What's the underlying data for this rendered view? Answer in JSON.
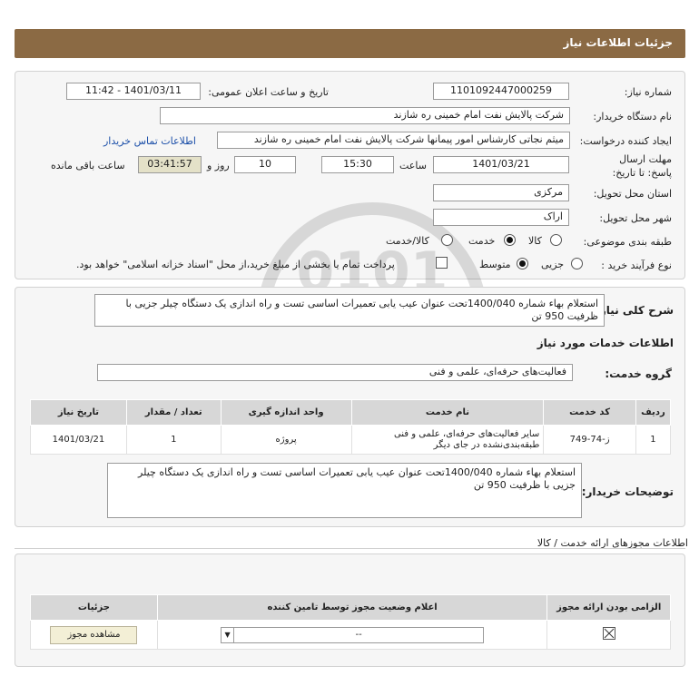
{
  "header": {
    "title": "جزئیات اطلاعات نیاز"
  },
  "need": {
    "need_number_label": "شماره نیاز:",
    "need_number": "1101092447000259",
    "announce_label": "تاریخ و ساعت اعلان عمومی:",
    "announce_value": "1401/03/11 - 11:42",
    "buyer_label": "نام دستگاه خریدار:",
    "buyer_value": "شرکت پالایش نفت امام خمینی  ره  شازند",
    "requester_label": "ایجاد کننده درخواست:",
    "requester_value": "میثم نجاتی کارشناس امور پیمانها شرکت پالایش نفت امام خمینی  ره  شازند",
    "contact_link": "اطلاعات تماس خریدار",
    "deadline_label": "مهلت ارسال پاسخ: تا تاریخ:",
    "deadline_date": "1401/03/21",
    "time_label": "ساعت",
    "deadline_time": "15:30",
    "days_value": "10",
    "days_label": "روز و",
    "remaining_value": "03:41:57",
    "remaining_label": "ساعت باقی مانده",
    "province_label": "استان محل تحویل:",
    "province_value": "مرکزی",
    "city_label": "شهر محل تحویل:",
    "city_value": "اراک",
    "category_label": "طبقه بندی موضوعی:",
    "category_options": [
      "کالا",
      "خدمت",
      "کالا/خدمت"
    ],
    "category_selected": "خدمت",
    "process_label": "نوع فرآیند خرید :",
    "process_options": [
      "جزیی",
      "متوسط"
    ],
    "process_selected": "متوسط",
    "treasury_note": "پرداخت تمام یا بخشی از مبلغ خرید،از محل \"اسناد خزانه اسلامی\" خواهد بود."
  },
  "description": {
    "label": "شرح کلی نیاز:",
    "text": "استعلام بهاء شماره 1400/040تحت عنوان عیب یابی تعمیرات اساسی تست و راه اندازی یک دستگاه چیلر جزیی با ظرفیت 950 تن"
  },
  "services": {
    "section_title": "اطلاعات خدمات مورد نیاز",
    "group_label": "گروه خدمت:",
    "group_value": "فعالیت‌های حرفه‌ای، علمی و فنی",
    "columns": [
      "ردیف",
      "کد خدمت",
      "نام خدمت",
      "واحد اندازه گیری",
      "تعداد / مقدار",
      "تاریخ نیاز"
    ],
    "rows": [
      {
        "row": "1",
        "code": "ز-74-749",
        "name": "سایر فعالیت‌های حرفه‌ای، علمی و فنی طبقه‌بندی‌نشده در جای دیگر",
        "unit": "پروژه",
        "qty": "1",
        "date": "1401/03/21"
      }
    ]
  },
  "buyer_notes": {
    "label": "توضیحات خریدار:",
    "text": "استعلام بهاء شماره 1400/040تحت عنوان عیب یابی تعمیرات اساسی تست و راه اندازی یک دستگاه چیلر جزیی با ظرفیت 950 تن"
  },
  "permits": {
    "section_title": "اطلاعات مجوزهای ارائه خدمت / کالا",
    "columns": [
      "الزامی بودن ارائه مجوز",
      "اعلام وضعیت مجوز توسط تامین کننده",
      "جزئیات"
    ],
    "select_value": "--",
    "view_button": "مشاهده مجوز"
  },
  "watermark": {
    "text": "ParsNamadData"
  }
}
